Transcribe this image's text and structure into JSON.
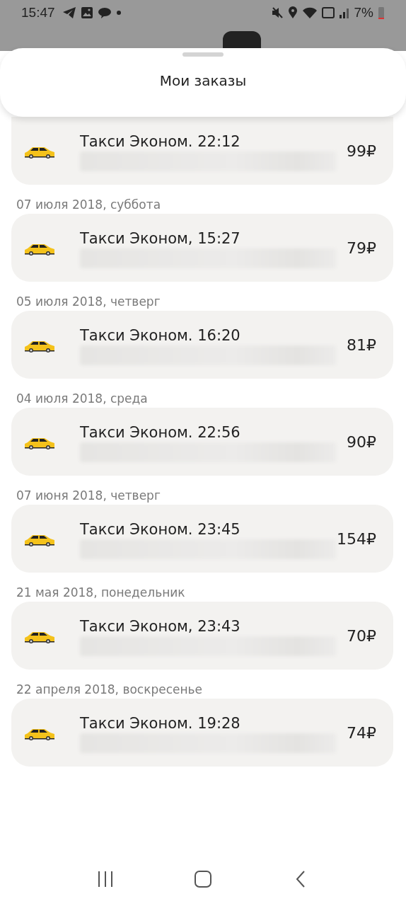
{
  "status_bar": {
    "time": "15:47",
    "battery": "7%"
  },
  "header": {
    "title": "Мои заказы"
  },
  "sections": [
    {
      "orders": [
        {
          "title": "Такси Эконом. 22:12",
          "price": "99₽"
        }
      ]
    },
    {
      "date": "07 июля 2018, суббота",
      "orders": [
        {
          "title": "Такси Эконом, 15:27",
          "price": "79₽"
        }
      ]
    },
    {
      "date": "05 июля 2018, четверг",
      "orders": [
        {
          "title": "Такси Эконом. 16:20",
          "price": "81₽"
        }
      ]
    },
    {
      "date": "04 июля 2018, среда",
      "orders": [
        {
          "title": "Такси Эконом. 22:56",
          "price": "90₽"
        }
      ]
    },
    {
      "date": "07 июня 2018, четверг",
      "orders": [
        {
          "title": "Такси Эконом. 23:45",
          "price": "154₽"
        }
      ]
    },
    {
      "date": "21 мая 2018, понедельник",
      "orders": [
        {
          "title": "Такси Эконом, 23:43",
          "price": "70₽"
        }
      ]
    },
    {
      "date": "22 апреля 2018, воскресенье",
      "orders": [
        {
          "title": "Такси Эконом. 19:28",
          "price": "74₽"
        }
      ]
    }
  ]
}
